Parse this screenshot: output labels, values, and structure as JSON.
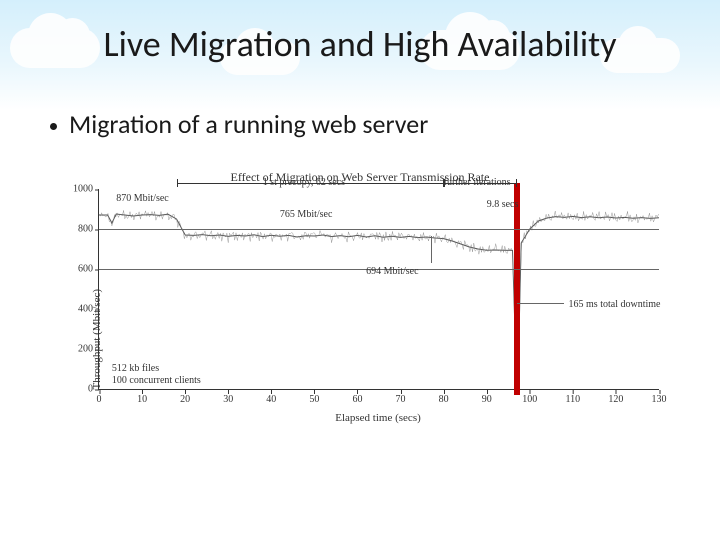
{
  "slide": {
    "title": "Live Migration and High Availability",
    "bullet": "Migration of a running web server"
  },
  "chart_data": {
    "type": "line",
    "title": "Effect of Migration on Web Server Transmission Rate",
    "xlabel": "Elapsed time (secs)",
    "ylabel": "Throughput (Mbit/sec)",
    "xlim": [
      0,
      130
    ],
    "ylim": [
      0,
      1000
    ],
    "xticks": [
      0,
      10,
      20,
      30,
      40,
      50,
      60,
      70,
      80,
      90,
      100,
      110,
      120,
      130
    ],
    "yticks": [
      0,
      200,
      400,
      600,
      800,
      1000
    ],
    "gridlines_y": [
      600,
      800
    ],
    "notes": [
      "512 kb files",
      "100 concurrent clients"
    ],
    "annotations": [
      {
        "label": "870 Mbit/sec",
        "at_x": 12,
        "at_y": 870
      },
      {
        "label": "1 st precopy, 62 secs",
        "range_x": [
          18,
          80
        ],
        "at_y": 1010
      },
      {
        "label": "765 Mbit/sec",
        "at_x": 50,
        "at_y": 765
      },
      {
        "label": "further iterations",
        "range_x": [
          80,
          97
        ],
        "at_y": 1010
      },
      {
        "label": "9.8 secs",
        "range_x": [
          80,
          90
        ],
        "at_y": 930
      },
      {
        "label": "694 Mbit/sec",
        "at_x": 88,
        "at_y": 694
      },
      {
        "label": "165 ms total downtime",
        "at_x": 97,
        "at_y": 430
      }
    ],
    "migration_complete_x": 97,
    "series": [
      {
        "name": "throughput",
        "x_y": [
          [
            0,
            870
          ],
          [
            2,
            870
          ],
          [
            3,
            830
          ],
          [
            4,
            875
          ],
          [
            6,
            870
          ],
          [
            8,
            865
          ],
          [
            10,
            870
          ],
          [
            12,
            872
          ],
          [
            14,
            868
          ],
          [
            16,
            874
          ],
          [
            18,
            850
          ],
          [
            20,
            770
          ],
          [
            22,
            768
          ],
          [
            24,
            772
          ],
          [
            26,
            766
          ],
          [
            28,
            770
          ],
          [
            30,
            763
          ],
          [
            32,
            768
          ],
          [
            34,
            765
          ],
          [
            36,
            771
          ],
          [
            38,
            762
          ],
          [
            40,
            769
          ],
          [
            42,
            764
          ],
          [
            44,
            768
          ],
          [
            46,
            760
          ],
          [
            48,
            766
          ],
          [
            50,
            765
          ],
          [
            52,
            770
          ],
          [
            54,
            762
          ],
          [
            56,
            767
          ],
          [
            58,
            761
          ],
          [
            60,
            768
          ],
          [
            62,
            760
          ],
          [
            64,
            766
          ],
          [
            66,
            759
          ],
          [
            68,
            764
          ],
          [
            70,
            758
          ],
          [
            72,
            763
          ],
          [
            74,
            757
          ],
          [
            76,
            760
          ],
          [
            78,
            755
          ],
          [
            80,
            752
          ],
          [
            82,
            740
          ],
          [
            84,
            725
          ],
          [
            86,
            710
          ],
          [
            88,
            700
          ],
          [
            90,
            694
          ],
          [
            92,
            695
          ],
          [
            94,
            694
          ],
          [
            96,
            693
          ],
          [
            97,
            0
          ],
          [
            97.2,
            0
          ],
          [
            98,
            730
          ],
          [
            100,
            800
          ],
          [
            102,
            840
          ],
          [
            104,
            855
          ],
          [
            106,
            862
          ],
          [
            108,
            858
          ],
          [
            110,
            863
          ],
          [
            112,
            857
          ],
          [
            114,
            861
          ],
          [
            116,
            856
          ],
          [
            118,
            860
          ],
          [
            120,
            855
          ],
          [
            122,
            858
          ],
          [
            124,
            854
          ],
          [
            126,
            857
          ],
          [
            128,
            853
          ],
          [
            130,
            856
          ]
        ]
      }
    ]
  }
}
